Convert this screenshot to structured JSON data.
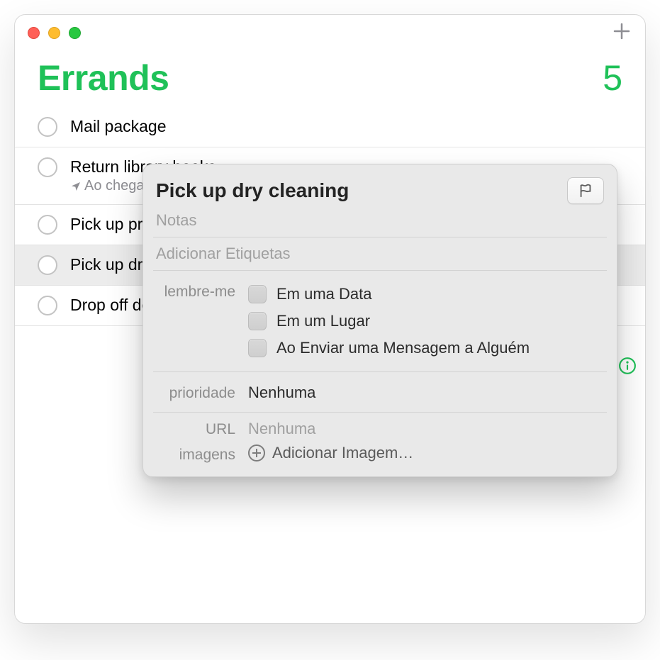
{
  "list": {
    "title": "Errands",
    "count": "5",
    "items": [
      {
        "title": "Mail package",
        "sub": null
      },
      {
        "title": "Return library books",
        "sub": "Ao chegar"
      },
      {
        "title": "Pick up prescription",
        "sub": null
      },
      {
        "title": "Pick up dry cleaning",
        "sub": null,
        "selected": true
      },
      {
        "title": "Drop off donations",
        "sub": null
      }
    ]
  },
  "popover": {
    "title": "Pick up dry cleaning",
    "notes_placeholder": "Notas",
    "tags_placeholder": "Adicionar Etiquetas",
    "remind_label": "lembre-me",
    "remind_options": [
      "Em uma Data",
      "Em um Lugar",
      "Ao Enviar uma Mensagem a Alguém"
    ],
    "priority_label": "prioridade",
    "priority_value": "Nenhuma",
    "url_label": "URL",
    "url_value": "Nenhuma",
    "images_label": "imagens",
    "images_action": "Adicionar Imagem…"
  }
}
